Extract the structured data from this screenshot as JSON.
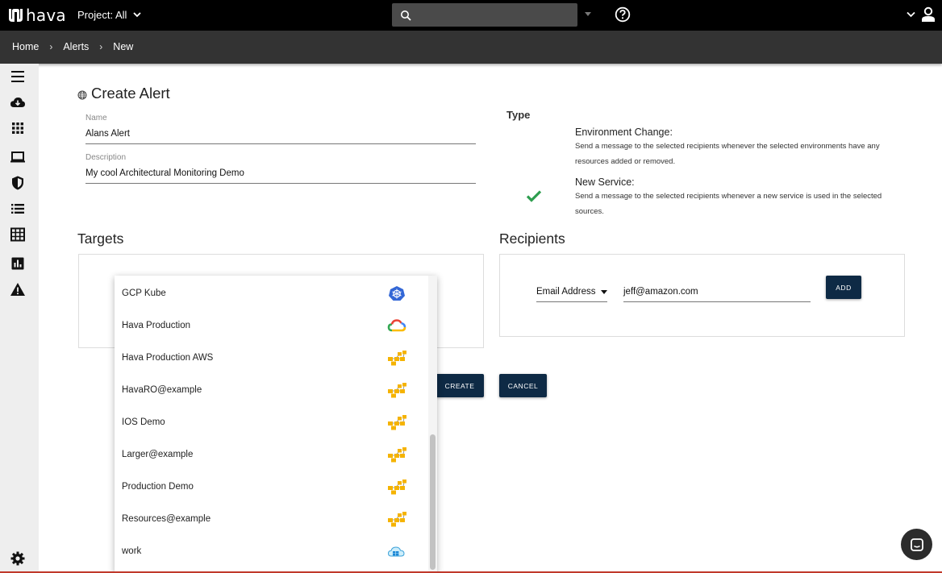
{
  "app": {
    "logo_text": "hava"
  },
  "topbar": {
    "project_label": "Project: All",
    "search_placeholder": ""
  },
  "breadcrumb": [
    "Home",
    "Alerts",
    "New"
  ],
  "page": {
    "title": "Create Alert"
  },
  "form": {
    "name_label": "Name",
    "name_value": "Alans Alert",
    "description_label": "Description",
    "description_value": "My cool Architectural Monitoring Demo"
  },
  "type": {
    "label": "Type",
    "options": [
      {
        "title": "Environment Change",
        "desc": "Send a message to the selected recipients whenever the selected environments have any resources added or removed.",
        "selected": false
      },
      {
        "title": "New Service",
        "desc": "Send a message to the selected recipients whenever a new service is used in the selected sources.",
        "selected": true
      }
    ],
    "check_color": "#2e9e4f"
  },
  "targets": {
    "heading": "Targets"
  },
  "recipients": {
    "heading": "Recipients",
    "type_value": "Email Address",
    "email_value": "jeff@amazon.com",
    "add_label": "ADD"
  },
  "actions": {
    "create_label": "CREATE",
    "cancel_label": "CANCEL"
  },
  "dropdown": {
    "items": [
      {
        "label": "GCP Kube",
        "icon": "kubernetes-icon"
      },
      {
        "label": "Hava Production",
        "icon": "google-cloud-icon"
      },
      {
        "label": "Hava Production AWS",
        "icon": "aws-icon"
      },
      {
        "label": "HavaRO@example",
        "icon": "aws-icon"
      },
      {
        "label": "IOS Demo",
        "icon": "aws-icon"
      },
      {
        "label": "Larger@example",
        "icon": "aws-icon"
      },
      {
        "label": "Production Demo",
        "icon": "aws-icon"
      },
      {
        "label": "Resources@example",
        "icon": "aws-icon"
      },
      {
        "label": "work",
        "icon": "azure-icon"
      }
    ]
  },
  "colors": {
    "accent": "#0e2a45",
    "topbar": "#000000",
    "crumbbar": "#333333"
  }
}
